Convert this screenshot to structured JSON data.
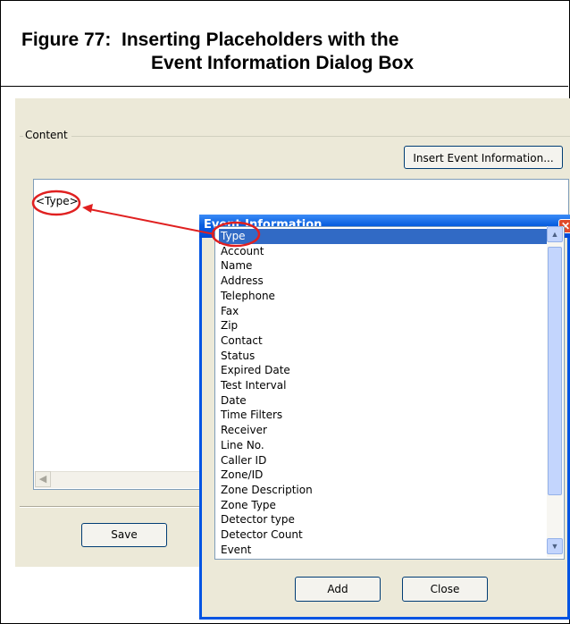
{
  "figure": {
    "title_line1": "Figure 77:  Inserting Placeholders with the",
    "title_line2": "Event Information Dialog Box"
  },
  "main": {
    "group_label": "Content",
    "insert_button": "Insert Event Information...",
    "editor_text": "<Type>",
    "save_button": "Save"
  },
  "dialog": {
    "title": "Event Information",
    "items": [
      "Type",
      "Account",
      "Name",
      "Address",
      "Telephone",
      "Fax",
      "Zip",
      "Contact",
      "Status",
      "Expired Date",
      "Test Interval",
      "Date",
      "Time Filters",
      "Receiver",
      "Line No.",
      "Caller ID",
      "Zone/ID",
      "Zone Description",
      "Zone Type",
      "Detector type",
      "Detector Count",
      "Event"
    ],
    "selected": "Type",
    "add_button": "Add",
    "close_button": "Close"
  },
  "colors": {
    "annotation": "#E02020",
    "selection": "#316AC5",
    "titlebar": "#0A5FE0"
  }
}
